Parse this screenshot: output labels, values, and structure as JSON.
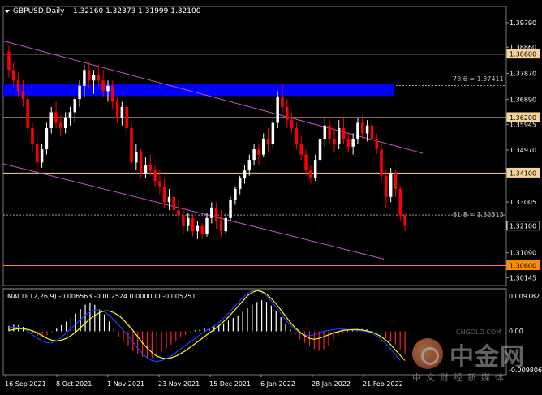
{
  "header": {
    "symbol": "GBPUSD,Daily",
    "ohlc": "1.32160 1.32373 1.31999 1.32100"
  },
  "price_axis": [
    "1.39790",
    "1.38860",
    "1.37870",
    "1.36890",
    "1.35945",
    "1.34970",
    "1.34100",
    "1.33005",
    "1.32100",
    "1.31090",
    "1.30600",
    "1.30145"
  ],
  "levels": [
    {
      "label": "1.38600",
      "value": 1.386,
      "color": "#f5d49a"
    },
    {
      "label": "1.36200",
      "value": 1.362,
      "color": "#f5d49a"
    },
    {
      "label": "1.34100",
      "value": 1.341,
      "color": "#f5d49a"
    },
    {
      "label": "1.30600",
      "value": 1.306,
      "color": "#ff8c00"
    },
    {
      "label": "1.32100",
      "value": 1.321,
      "color": "#ffffff"
    }
  ],
  "fib_levels": [
    {
      "label": "78.6 = 1.37411",
      "value": 1.37411
    },
    {
      "label": "61.8 = 1.32513",
      "value": 1.32513
    }
  ],
  "macd": {
    "label": "MACD(12,26,9) -0.006563 -0.002524 0.000000 -0.005251",
    "axis": [
      "0.009182",
      "0.00",
      "-0.009806"
    ]
  },
  "x_axis": [
    "16 Sep 2021",
    "8 Oct 2021",
    "1 Nov 2021",
    "23 Nov 2021",
    "15 Dec 2021",
    "6 Jan 2022",
    "28 Jan 2022",
    "21 Feb 2022"
  ],
  "watermark": {
    "title": "中金网",
    "sub": "中文财经新媒体",
    "site": "CNGOLD.COM"
  },
  "colors": {
    "bull": "#ffffff",
    "bear": "#ff0000",
    "zone": "#0000ff",
    "channel": "#c850c8",
    "signal": "#ffff00",
    "macd_line": "#1e3cff"
  },
  "chart_data": {
    "type": "candlestick",
    "ylim": [
      1.2985,
      1.404
    ],
    "series": [
      {
        "name": "GBPUSD",
        "ohlc": [
          [
            1.387,
            1.389,
            1.377,
            1.38
          ],
          [
            1.38,
            1.383,
            1.374,
            1.376
          ],
          [
            1.376,
            1.379,
            1.37,
            1.372
          ],
          [
            1.372,
            1.376,
            1.366,
            1.369
          ],
          [
            1.369,
            1.372,
            1.356,
            1.358
          ],
          [
            1.358,
            1.36,
            1.349,
            1.352
          ],
          [
            1.352,
            1.356,
            1.342,
            1.345
          ],
          [
            1.345,
            1.352,
            1.343,
            1.35
          ],
          [
            1.35,
            1.36,
            1.348,
            1.358
          ],
          [
            1.358,
            1.366,
            1.356,
            1.364
          ],
          [
            1.364,
            1.368,
            1.358,
            1.36
          ],
          [
            1.36,
            1.363,
            1.355,
            1.358
          ],
          [
            1.358,
            1.364,
            1.356,
            1.362
          ],
          [
            1.362,
            1.366,
            1.359,
            1.364
          ],
          [
            1.364,
            1.37,
            1.36,
            1.369
          ],
          [
            1.369,
            1.376,
            1.366,
            1.374
          ],
          [
            1.374,
            1.382,
            1.37,
            1.38
          ],
          [
            1.38,
            1.383,
            1.373,
            1.376
          ],
          [
            1.376,
            1.38,
            1.371,
            1.378
          ],
          [
            1.378,
            1.382,
            1.374,
            1.376
          ],
          [
            1.376,
            1.38,
            1.37,
            1.372
          ],
          [
            1.372,
            1.376,
            1.368,
            1.374
          ],
          [
            1.374,
            1.376,
            1.365,
            1.368
          ],
          [
            1.368,
            1.37,
            1.36,
            1.362
          ],
          [
            1.362,
            1.368,
            1.359,
            1.366
          ],
          [
            1.366,
            1.368,
            1.356,
            1.358
          ],
          [
            1.358,
            1.36,
            1.343,
            1.345
          ],
          [
            1.345,
            1.352,
            1.342,
            1.349
          ],
          [
            1.349,
            1.35,
            1.339,
            1.341
          ],
          [
            1.341,
            1.347,
            1.339,
            1.344
          ],
          [
            1.344,
            1.348,
            1.34,
            1.342
          ],
          [
            1.342,
            1.344,
            1.336,
            1.338
          ],
          [
            1.338,
            1.342,
            1.333,
            1.336
          ],
          [
            1.336,
            1.339,
            1.328,
            1.33
          ],
          [
            1.33,
            1.335,
            1.327,
            1.332
          ],
          [
            1.332,
            1.334,
            1.325,
            1.327
          ],
          [
            1.327,
            1.331,
            1.323,
            1.325
          ],
          [
            1.325,
            1.328,
            1.318,
            1.321
          ],
          [
            1.321,
            1.326,
            1.319,
            1.324
          ],
          [
            1.324,
            1.325,
            1.317,
            1.319
          ],
          [
            1.319,
            1.323,
            1.316,
            1.321
          ],
          [
            1.321,
            1.322,
            1.316,
            1.318
          ],
          [
            1.318,
            1.326,
            1.317,
            1.324
          ],
          [
            1.324,
            1.33,
            1.322,
            1.328
          ],
          [
            1.328,
            1.33,
            1.32,
            1.323
          ],
          [
            1.323,
            1.327,
            1.317,
            1.319
          ],
          [
            1.319,
            1.326,
            1.318,
            1.324
          ],
          [
            1.324,
            1.332,
            1.323,
            1.331
          ],
          [
            1.331,
            1.336,
            1.329,
            1.335
          ],
          [
            1.335,
            1.34,
            1.333,
            1.339
          ],
          [
            1.339,
            1.344,
            1.337,
            1.342
          ],
          [
            1.342,
            1.348,
            1.34,
            1.346
          ],
          [
            1.346,
            1.352,
            1.344,
            1.35
          ],
          [
            1.35,
            1.352,
            1.344,
            1.348
          ],
          [
            1.348,
            1.356,
            1.347,
            1.354
          ],
          [
            1.354,
            1.358,
            1.349,
            1.352
          ],
          [
            1.352,
            1.362,
            1.35,
            1.36
          ],
          [
            1.36,
            1.372,
            1.358,
            1.37
          ],
          [
            1.37,
            1.375,
            1.364,
            1.366
          ],
          [
            1.366,
            1.369,
            1.358,
            1.361
          ],
          [
            1.361,
            1.364,
            1.356,
            1.358
          ],
          [
            1.358,
            1.36,
            1.35,
            1.352
          ],
          [
            1.352,
            1.355,
            1.346,
            1.348
          ],
          [
            1.348,
            1.35,
            1.34,
            1.342
          ],
          [
            1.342,
            1.344,
            1.337,
            1.339
          ],
          [
            1.339,
            1.348,
            1.338,
            1.346
          ],
          [
            1.346,
            1.356,
            1.344,
            1.354
          ],
          [
            1.354,
            1.362,
            1.351,
            1.359
          ],
          [
            1.359,
            1.361,
            1.352,
            1.354
          ],
          [
            1.354,
            1.358,
            1.349,
            1.352
          ],
          [
            1.352,
            1.361,
            1.35,
            1.358
          ],
          [
            1.358,
            1.362,
            1.352,
            1.354
          ],
          [
            1.354,
            1.356,
            1.349,
            1.351
          ],
          [
            1.351,
            1.356,
            1.348,
            1.354
          ],
          [
            1.354,
            1.362,
            1.352,
            1.36
          ],
          [
            1.36,
            1.363,
            1.354,
            1.356
          ],
          [
            1.356,
            1.361,
            1.353,
            1.359
          ],
          [
            1.359,
            1.361,
            1.352,
            1.354
          ],
          [
            1.354,
            1.356,
            1.348,
            1.35
          ],
          [
            1.35,
            1.352,
            1.338,
            1.34
          ],
          [
            1.34,
            1.342,
            1.328,
            1.332
          ],
          [
            1.332,
            1.343,
            1.33,
            1.341
          ],
          [
            1.341,
            1.342,
            1.332,
            1.335
          ],
          [
            1.335,
            1.336,
            1.323,
            1.325
          ],
          [
            1.325,
            1.326,
            1.319,
            1.321
          ]
        ]
      }
    ],
    "macd_hist": [
      0.0012,
      0.0015,
      0.0014,
      0.001,
      0.0004,
      -0.0004,
      -0.001,
      -0.0012,
      -0.0008,
      -0.0002,
      0.0006,
      0.0014,
      0.0022,
      0.003,
      0.004,
      0.005,
      0.006,
      0.0064,
      0.006,
      0.005,
      0.0038,
      0.0022,
      0.0005,
      -0.0012,
      -0.0024,
      -0.0034,
      -0.0045,
      -0.0052,
      -0.0058,
      -0.0062,
      -0.006,
      -0.0054,
      -0.0046,
      -0.0038,
      -0.003,
      -0.0022,
      -0.0014,
      -0.0008,
      -0.0002,
      0.0002,
      0.0004,
      0.0006,
      0.0008,
      0.0011,
      0.0014,
      0.0018,
      0.0024,
      0.003,
      0.0036,
      0.0044,
      0.0052,
      0.006,
      0.0066,
      0.007,
      0.0066,
      0.0058,
      0.0046,
      0.0032,
      0.0018,
      0.0004,
      -0.0008,
      -0.0018,
      -0.0026,
      -0.0034,
      -0.004,
      -0.0044,
      -0.004,
      -0.0032,
      -0.0022,
      -0.0012,
      -0.0004,
      0.0002,
      0.0004,
      0.0005,
      0.0005,
      0.0004,
      0.0001,
      -0.0004,
      -0.001,
      -0.0016,
      -0.0022,
      -0.003,
      -0.004,
      -0.005
    ],
    "macd_line": [
      0.0008,
      0.001,
      0.0009,
      0.0006,
      0.0,
      -0.0008,
      -0.0016,
      -0.0022,
      -0.0026,
      -0.0026,
      -0.0022,
      -0.0014,
      -0.0004,
      0.0006,
      0.0016,
      0.0026,
      0.0036,
      0.0044,
      0.0048,
      0.0048,
      0.0044,
      0.0036,
      0.0026,
      0.0014,
      0.0002,
      -0.001,
      -0.0024,
      -0.0038,
      -0.005,
      -0.006,
      -0.0066,
      -0.0068,
      -0.0066,
      -0.0062,
      -0.0056,
      -0.0048,
      -0.004,
      -0.0032,
      -0.0024,
      -0.0016,
      -0.0008,
      -0.0001,
      0.0006,
      0.0012,
      0.002,
      0.003,
      0.004,
      0.0052,
      0.0064,
      0.0076,
      0.0086,
      0.0092,
      0.0092,
      0.0088,
      0.008,
      0.0068,
      0.0054,
      0.004,
      0.0026,
      0.0014,
      0.0004,
      -0.0004,
      -0.0008,
      -0.001,
      -0.0008,
      -0.0004,
      0.0,
      0.0002,
      0.0004,
      0.0005,
      0.0005,
      0.0004,
      0.0003,
      0.0002,
      0.0001,
      -0.0001,
      -0.0004,
      -0.001,
      -0.0018,
      -0.0028,
      -0.004,
      -0.0052,
      -0.0066
    ],
    "signal_line": [
      0.0002,
      0.0004,
      0.0006,
      0.0006,
      0.0004,
      0.0001,
      -0.0004,
      -0.001,
      -0.0016,
      -0.002,
      -0.0022,
      -0.002,
      -0.0016,
      -0.001,
      -0.0002,
      0.0008,
      0.0018,
      0.0028,
      0.0036,
      0.0042,
      0.0046,
      0.0046,
      0.0042,
      0.0036,
      0.0026,
      0.0014,
      0.0002,
      -0.0012,
      -0.0026,
      -0.0038,
      -0.0048,
      -0.0056,
      -0.006,
      -0.0062,
      -0.006,
      -0.0056,
      -0.005,
      -0.0044,
      -0.0036,
      -0.0028,
      -0.002,
      -0.0012,
      -0.0004,
      0.0004,
      0.0012,
      0.0022,
      0.0032,
      0.0044,
      0.0056,
      0.0068,
      0.008,
      0.0088,
      0.0092,
      0.009,
      0.0084,
      0.0074,
      0.0062,
      0.0048,
      0.0034,
      0.002,
      0.0008,
      -0.0002,
      -0.001,
      -0.0016,
      -0.0018,
      -0.0016,
      -0.0012,
      -0.0008,
      -0.0004,
      -0.0001,
      0.0002,
      0.0003,
      0.0004,
      0.0004,
      0.0003,
      0.0001,
      -0.0002,
      -0.0006,
      -0.0012,
      -0.002,
      -0.003,
      -0.0042,
      -0.0054,
      -0.0066
    ],
    "macd_ylim": [
      -0.0098,
      0.0096
    ]
  }
}
